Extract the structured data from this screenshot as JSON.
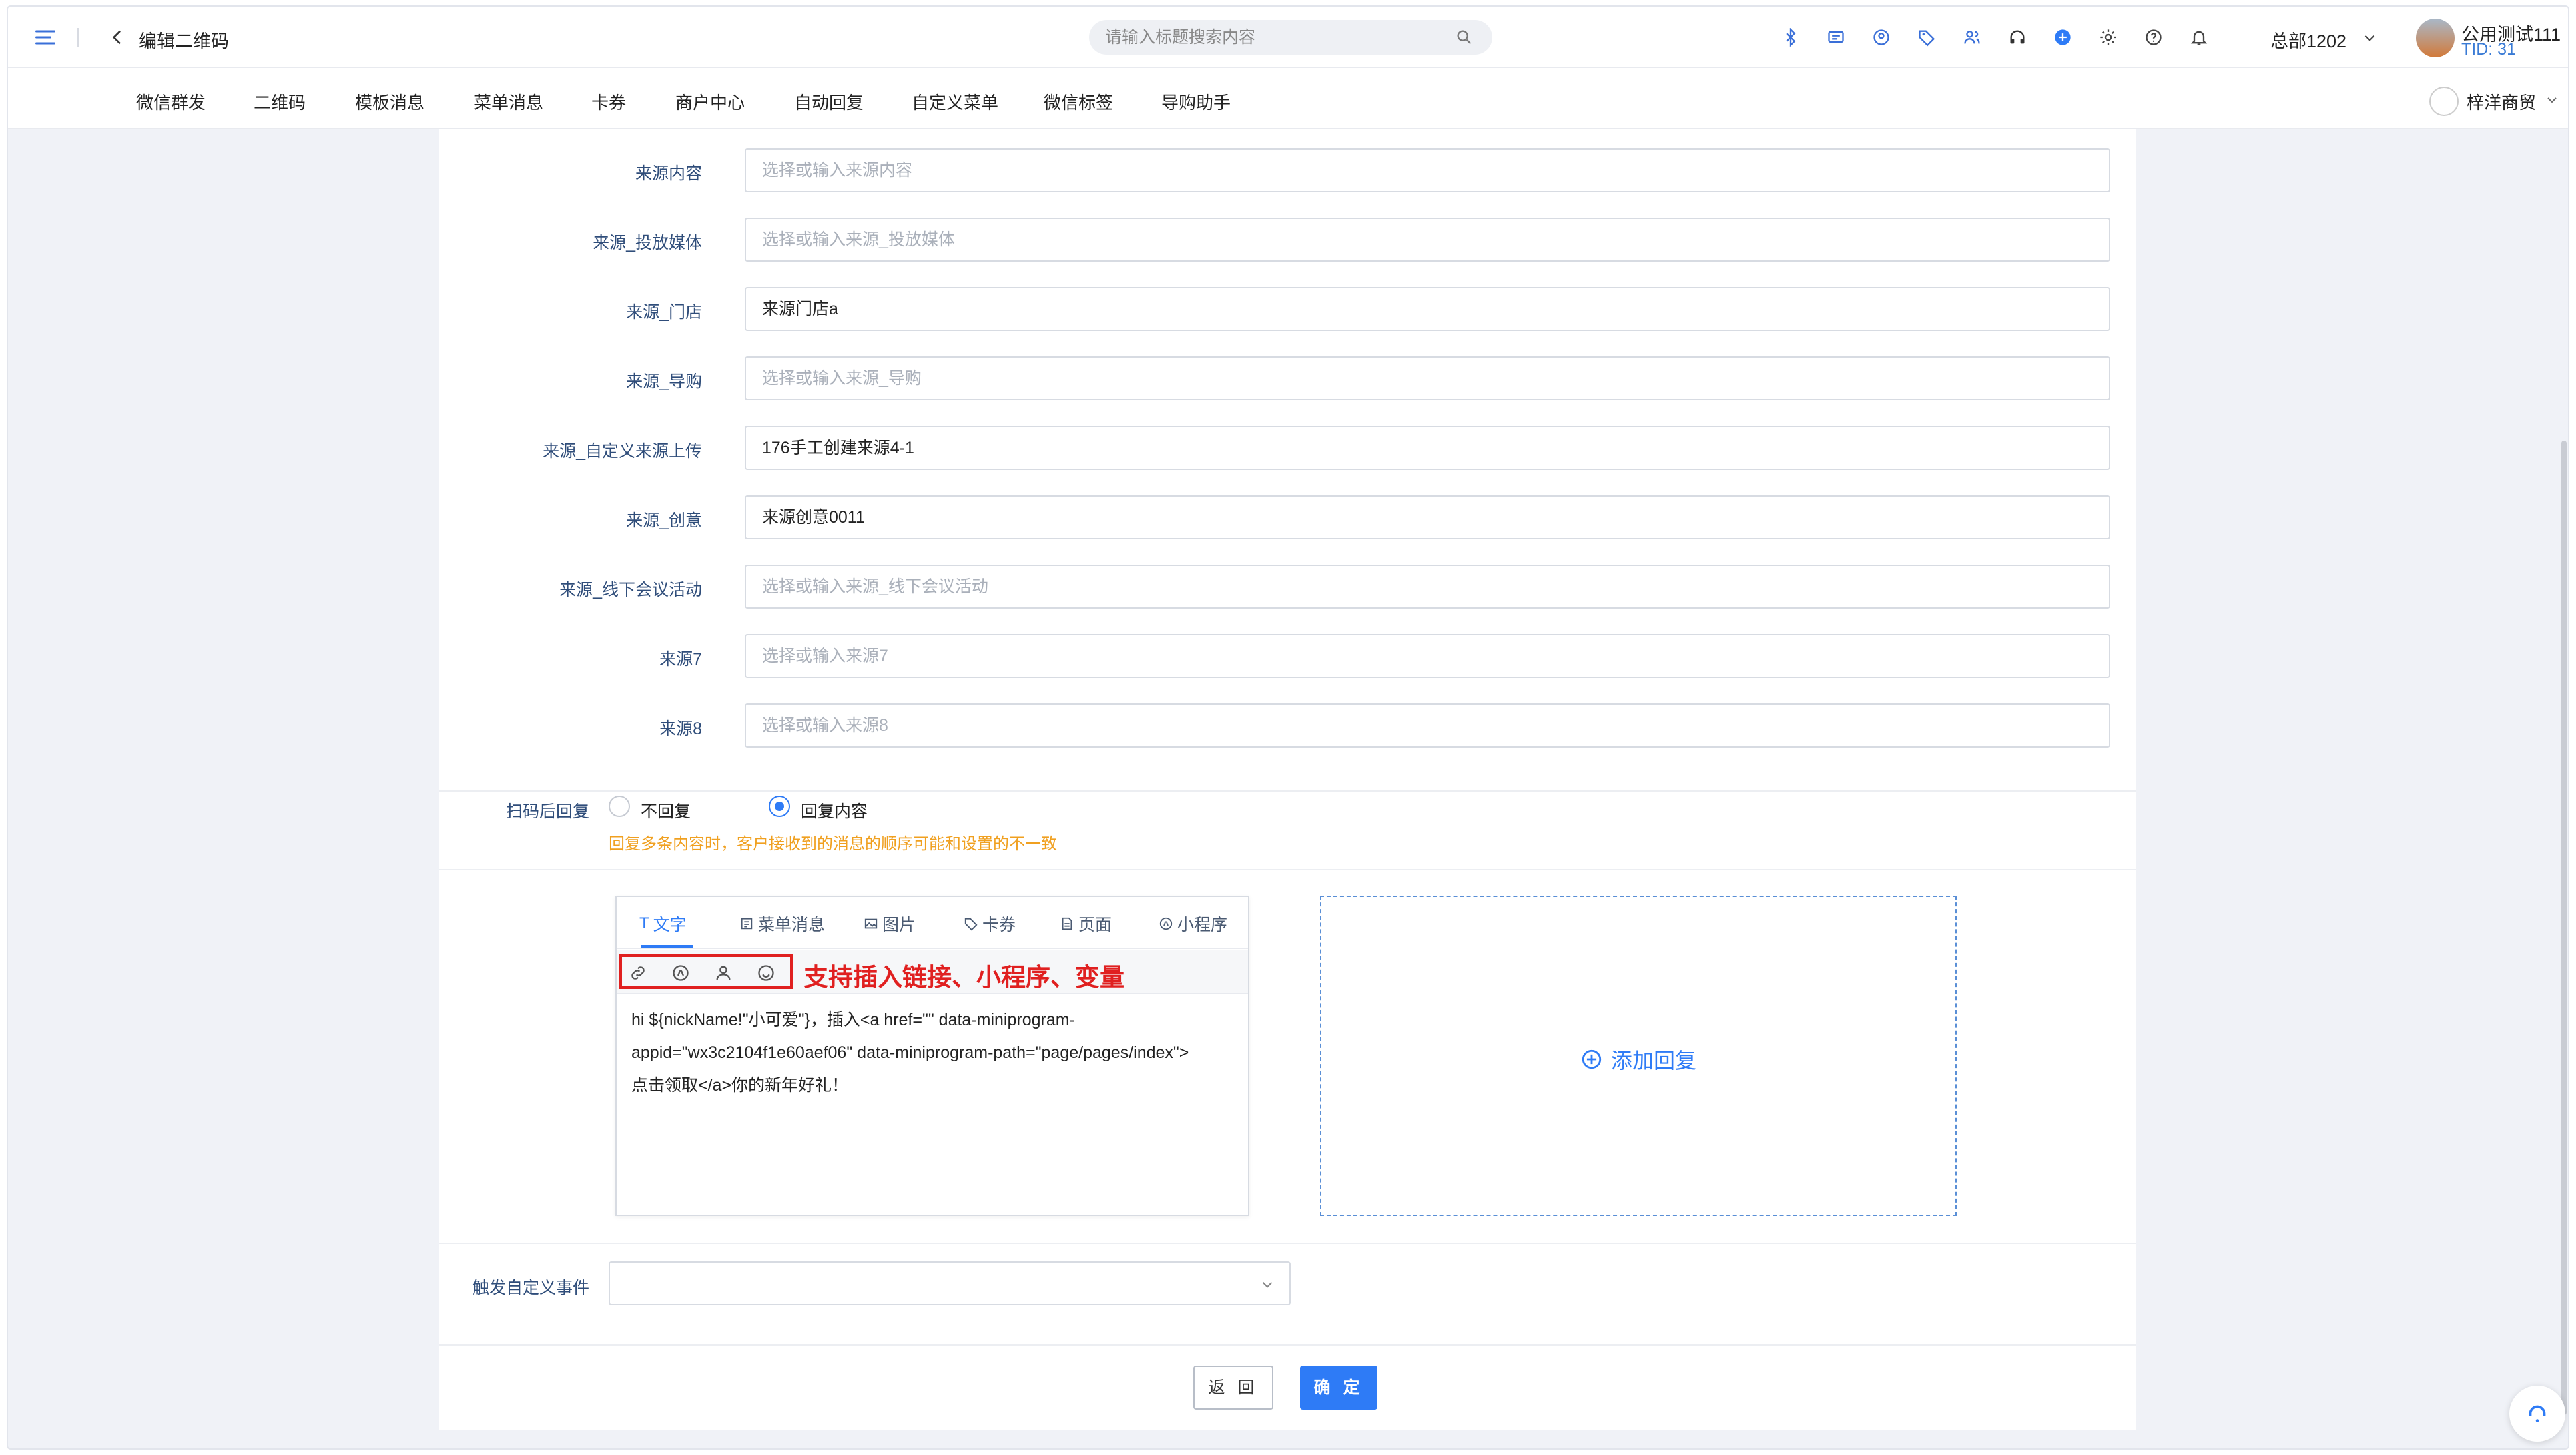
{
  "header": {
    "page_title": "编辑二维码",
    "search_placeholder": "请输入标题搜索内容",
    "org": "总部1202",
    "user_name": "公用测试111",
    "user_tid": "TID: 31"
  },
  "nav": {
    "items": [
      "微信群发",
      "二维码",
      "模板消息",
      "菜单消息",
      "卡券",
      "商户中心",
      "自动回复",
      "自定义菜单",
      "微信标签",
      "导购助手"
    ],
    "brand": "梓洋商贸"
  },
  "form": {
    "fields": [
      {
        "label": "来源内容",
        "value": "",
        "placeholder": "选择或输入来源内容"
      },
      {
        "label": "来源_投放媒体",
        "value": "",
        "placeholder": "选择或输入来源_投放媒体"
      },
      {
        "label": "来源_门店",
        "value": "来源门店a",
        "placeholder": ""
      },
      {
        "label": "来源_导购",
        "value": "",
        "placeholder": "选择或输入来源_导购"
      },
      {
        "label": "来源_自定义来源上传",
        "value": "176手工创建来源4-1",
        "placeholder": ""
      },
      {
        "label": "来源_创意",
        "value": "来源创意0011",
        "placeholder": ""
      },
      {
        "label": "来源_线下会议活动",
        "value": "",
        "placeholder": "选择或输入来源_线下会议活动"
      },
      {
        "label": "来源7",
        "value": "",
        "placeholder": "选择或输入来源7"
      },
      {
        "label": "来源8",
        "value": "",
        "placeholder": "选择或输入来源8"
      }
    ],
    "reply": {
      "label": "扫码后回复",
      "option_none": "不回复",
      "option_content": "回复内容",
      "selected": "回复内容",
      "warning": "回复多条内容时，客户接收到的消息的顺序可能和设置的不一致"
    },
    "editor": {
      "tabs": [
        "文字",
        "菜单消息",
        "图片",
        "卡券",
        "页面",
        "小程序"
      ],
      "active_tab": "文字",
      "annotation": "支持插入链接、小程序、变量",
      "body_line1": "hi ${nickName!\"小可爱\"}，插入<a href=\"\" data-miniprogram-",
      "body_line2": "appid=\"wx3c2104f1e60aef06\" data-miniprogram-path=\"page/pages/index\">",
      "body_line3": "点击领取</a>你的新年好礼！"
    },
    "add_reply": "添加回复",
    "event_label": "触发自定义事件",
    "event_value": "",
    "back_button": "返 回",
    "confirm_button": "确 定"
  },
  "colors": {
    "accent": "#2e7bf6",
    "annotation_red": "#e02020",
    "warning": "#f0a020",
    "label": "#2f4d7a"
  }
}
